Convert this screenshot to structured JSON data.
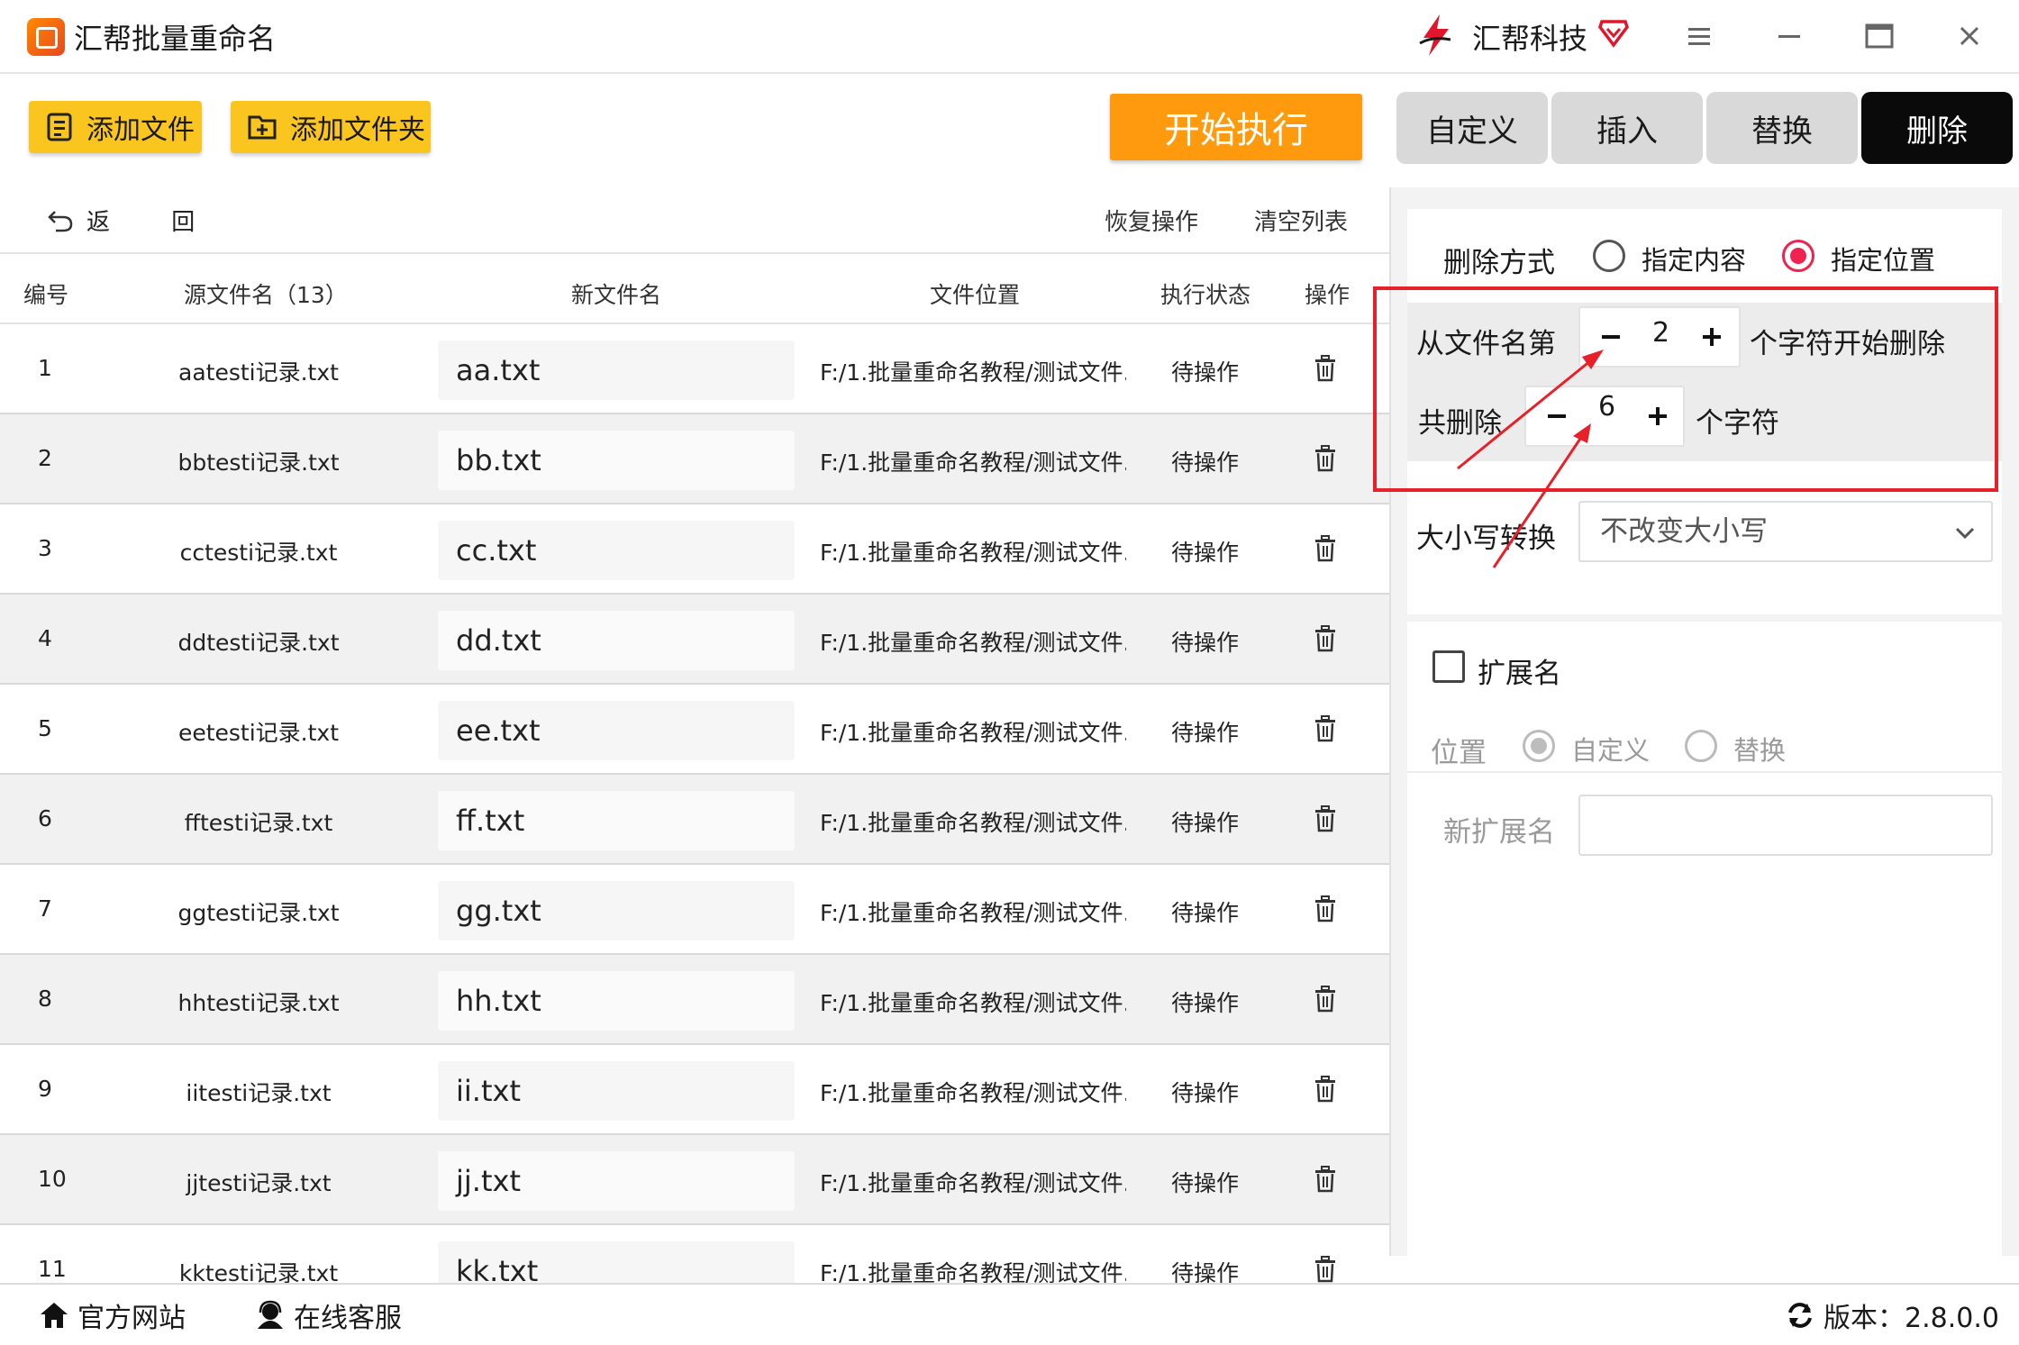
{
  "window": {
    "title": "汇帮批量重命名",
    "brand_name": "汇帮科技"
  },
  "toolbar": {
    "add_file": "添加文件",
    "add_folder": "添加文件夹",
    "start": "开始执行",
    "modes": [
      "自定义",
      "插入",
      "替换",
      "删除"
    ],
    "active_mode": "删除"
  },
  "actions": {
    "back": "返 回",
    "restore": "恢复操作",
    "clear": "清空列表"
  },
  "table": {
    "headers": {
      "num": "编号",
      "source": "源文件名（13）",
      "newname": "新文件名",
      "location": "文件位置",
      "status": "执行状态",
      "op": "操作"
    },
    "rows": [
      {
        "num": "1",
        "source": "aatesti记录.txt",
        "newname": "aa.txt",
        "location": "F:/1.批量重命名教程/测试文件...",
        "status": "待操作"
      },
      {
        "num": "2",
        "source": "bbtesti记录.txt",
        "newname": "bb.txt",
        "location": "F:/1.批量重命名教程/测试文件...",
        "status": "待操作"
      },
      {
        "num": "3",
        "source": "cctesti记录.txt",
        "newname": "cc.txt",
        "location": "F:/1.批量重命名教程/测试文件...",
        "status": "待操作"
      },
      {
        "num": "4",
        "source": "ddtesti记录.txt",
        "newname": "dd.txt",
        "location": "F:/1.批量重命名教程/测试文件...",
        "status": "待操作"
      },
      {
        "num": "5",
        "source": "eetesti记录.txt",
        "newname": "ee.txt",
        "location": "F:/1.批量重命名教程/测试文件...",
        "status": "待操作"
      },
      {
        "num": "6",
        "source": "fftesti记录.txt",
        "newname": "ff.txt",
        "location": "F:/1.批量重命名教程/测试文件...",
        "status": "待操作"
      },
      {
        "num": "7",
        "source": "ggtesti记录.txt",
        "newname": "gg.txt",
        "location": "F:/1.批量重命名教程/测试文件...",
        "status": "待操作"
      },
      {
        "num": "8",
        "source": "hhtesti记录.txt",
        "newname": "hh.txt",
        "location": "F:/1.批量重命名教程/测试文件...",
        "status": "待操作"
      },
      {
        "num": "9",
        "source": "iitesti记录.txt",
        "newname": "ii.txt",
        "location": "F:/1.批量重命名教程/测试文件...",
        "status": "待操作"
      },
      {
        "num": "10",
        "source": "jjtesti记录.txt",
        "newname": "jj.txt",
        "location": "F:/1.批量重命名教程/测试文件...",
        "status": "待操作"
      },
      {
        "num": "11",
        "source": "kktesti记录.txt",
        "newname": "kk.txt",
        "location": "F:/1.批量重命名教程/测试文件...",
        "status": "待操作"
      }
    ]
  },
  "panel": {
    "delete_mode_label": "删除方式",
    "option_content": "指定内容",
    "option_position": "指定位置",
    "selected_option": "指定位置",
    "from_label": "从文件名第",
    "from_value": "2",
    "from_suffix": "个字符开始删除",
    "count_label": "共删除",
    "count_value": "6",
    "count_suffix": "个字符",
    "case_label": "大小写转换",
    "case_value": "不改变大小写",
    "ext_label": "扩展名",
    "ext_checked": false,
    "pos_label": "位置",
    "pos_custom": "自定义",
    "pos_replace": "替换",
    "new_ext_label": "新扩展名",
    "new_ext_value": ""
  },
  "footer": {
    "website": "官方网站",
    "support": "在线客服",
    "version": "版本：2.8.0.0"
  },
  "colors": {
    "accent_yellow": "#f9c51e",
    "start_orange": "#ff9a0e",
    "radio_red": "#f0224f",
    "annotation_red": "#e8202a"
  }
}
